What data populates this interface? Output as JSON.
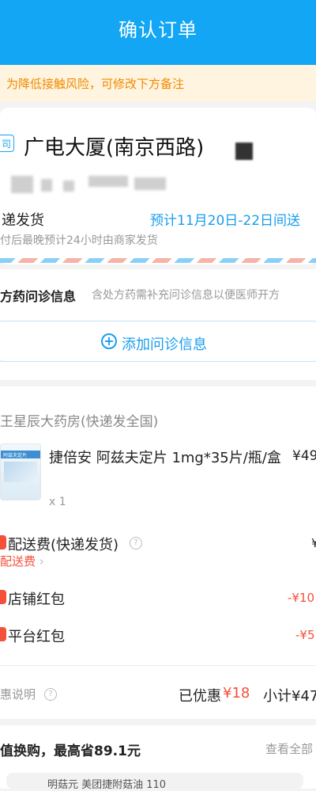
{
  "header": {
    "title": "确认订单"
  },
  "notice": {
    "text": "为降低接触风险，可修改下方备注"
  },
  "address": {
    "tag": "司",
    "title": "广电大厦(南京西路)",
    "shipping_label": "递发货",
    "shipping_date": "预计11月20日-22日间送",
    "shipping_note": "付后最晚预计24小时由商家发货"
  },
  "prescription": {
    "title": "方药问诊信息",
    "subtitle": "含处方药需补充问诊信息以便医师开方",
    "add_button": "添加问诊信息"
  },
  "shop": {
    "name": "王星辰大药房(快递发全国)",
    "product": {
      "name": "捷倍安 阿兹夫定片 1mg*35片/瓶/盒",
      "price": "¥49",
      "qty": "x 1",
      "thumb_label": "阿兹夫定片"
    },
    "delivery_label": "配送费(快递发货)",
    "delivery_sub": "配送费",
    "delivery_value": "¥",
    "store_coupon_label": "店铺红包",
    "store_coupon_value": "-¥10",
    "platform_coupon_label": "平台红包",
    "platform_coupon_value": "-¥5",
    "promo_label": "惠说明",
    "saved_label": "已优惠",
    "saved_value": "¥18",
    "subtotal": "小计¥47"
  },
  "swap": {
    "title": "值换购，最高省89.1元",
    "see_all": "查看全部",
    "peek": "明菇元 美团捷附菇油 110"
  },
  "colors": {
    "accent": "#12a6f5",
    "link": "#1a9ded",
    "warning": "#f08a00",
    "price_red": "#f4503a"
  }
}
